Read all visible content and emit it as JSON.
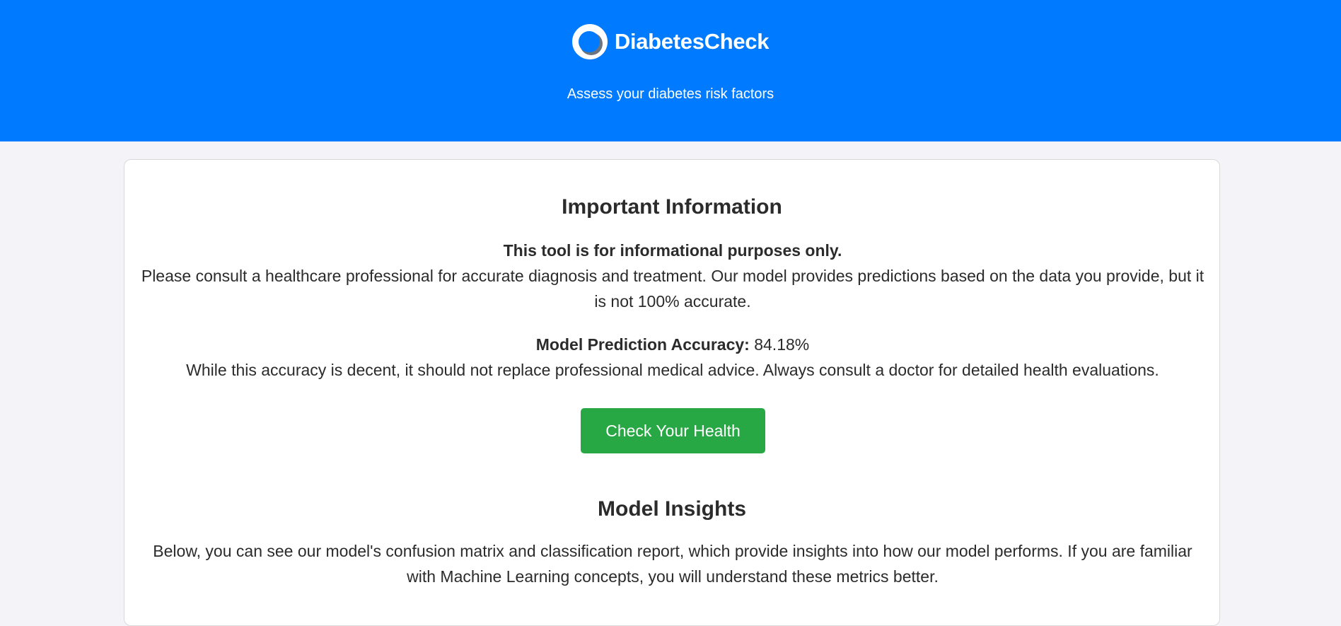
{
  "header": {
    "brand_name": "DiabetesCheck",
    "tagline": "Assess your diabetes risk factors",
    "logo_icon": "ring-logo-icon",
    "background_color": "#007bff"
  },
  "info": {
    "title": "Important Information",
    "disclaimer_bold": "This tool is for informational purposes only.",
    "disclaimer_text": "Please consult a healthcare professional for accurate diagnosis and treatment. Our model provides predictions based on the data you provide, but it is not 100% accurate.",
    "accuracy_label": "Model Prediction Accuracy:",
    "accuracy_value": "84.18%",
    "accuracy_note": "While this accuracy is decent, it should not replace professional medical advice. Always consult a doctor for detailed health evaluations."
  },
  "cta": {
    "label": "Check Your Health",
    "color": "#28a745"
  },
  "insights": {
    "title": "Model Insights",
    "text": "Below, you can see our model's confusion matrix and classification report, which provide insights into how our model performs. If you are familiar with Machine Learning concepts, you will understand these metrics better."
  }
}
